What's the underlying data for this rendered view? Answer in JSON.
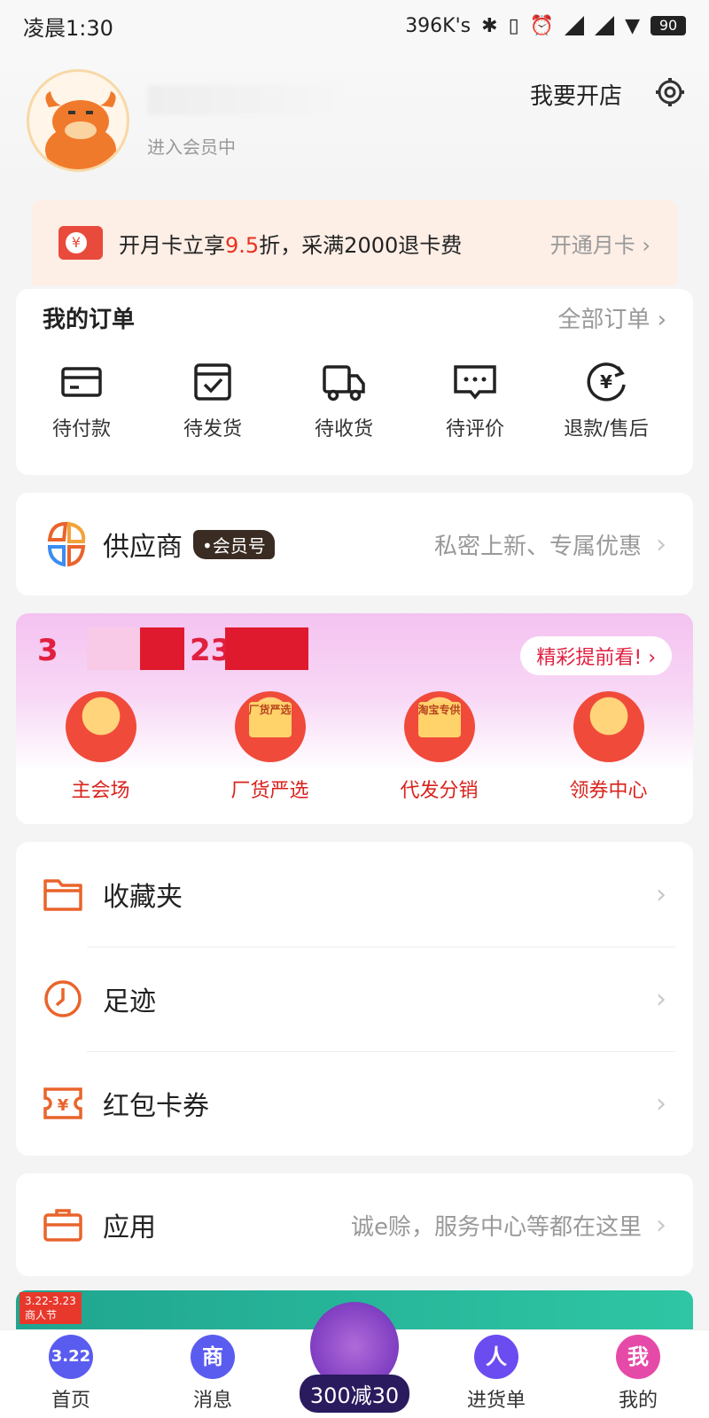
{
  "status_bar": {
    "time": "凌晨1:30",
    "net_speed": "396K's",
    "battery": "90"
  },
  "profile": {
    "member_text": "进入会员中",
    "open_shop": "我要开店"
  },
  "month_card": {
    "text_pre": "开月卡立享",
    "text_hl": "9.5",
    "text_post": "折，采满2000退卡费",
    "link": "开通月卡"
  },
  "orders": {
    "title": "我的订单",
    "all": "全部订单",
    "items": [
      {
        "label": "待付款"
      },
      {
        "label": "待发货"
      },
      {
        "label": "待收货"
      },
      {
        "label": "待评价"
      },
      {
        "label": "退款/售后"
      }
    ]
  },
  "supplier": {
    "title": "供应商",
    "badge": "•会员号",
    "subtitle": "私密上新、专属优惠"
  },
  "promo": {
    "date_prefix": "3",
    "date_mid": "23",
    "preview": "精彩提前看! ›",
    "items": [
      {
        "label": "主会场",
        "tag": ""
      },
      {
        "label": "厂货严选",
        "tag": "厂货严选"
      },
      {
        "label": "代发分销",
        "tag": "淘宝专供"
      },
      {
        "label": "领券中心",
        "tag": ""
      }
    ]
  },
  "list": {
    "favorites": "收藏夹",
    "footprints": "足迹",
    "coupons": "红包卡券"
  },
  "apps": {
    "label": "应用",
    "subtitle": "诚e赊，服务中心等都在这里"
  },
  "banner": {
    "tag_line1": "3.22-3.23",
    "tag_line2": "商人节"
  },
  "tabbar": {
    "home": {
      "label": "首页",
      "icon_text": "3.22"
    },
    "messages": {
      "label": "消息",
      "icon_text": "商"
    },
    "center": {
      "label": "300减30"
    },
    "cart": {
      "label": "进货单",
      "icon_text": "人"
    },
    "mine": {
      "label": "我的",
      "icon_text": "我"
    }
  },
  "colors": {
    "accent": "#e8321f",
    "orange_icon": "#e9642b",
    "muted": "#999999"
  }
}
